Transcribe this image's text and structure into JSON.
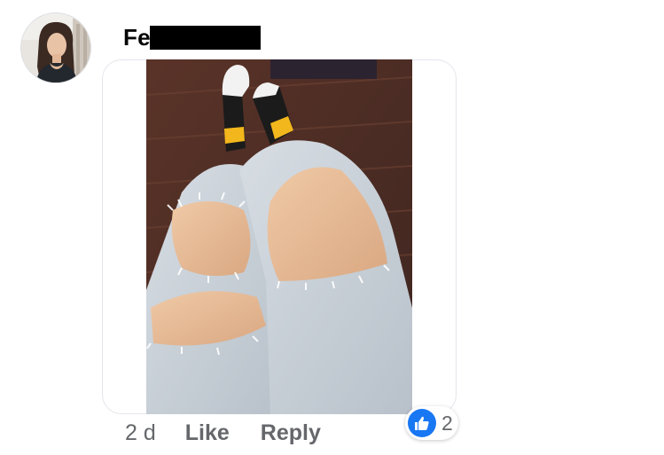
{
  "comment": {
    "author_visible_prefix": "Fe",
    "timestamp": "2 d",
    "actions": {
      "like_label": "Like",
      "reply_label": "Reply"
    },
    "reactions": {
      "type": "like",
      "count": "2",
      "color": "#1877f2"
    },
    "attachment": "photo"
  },
  "colors": {
    "meta_text": "#65676b",
    "name_text": "#050505",
    "like_blue": "#1877f2",
    "redaction": "#000000"
  },
  "icons": {
    "reaction": "thumbs-up-icon"
  }
}
